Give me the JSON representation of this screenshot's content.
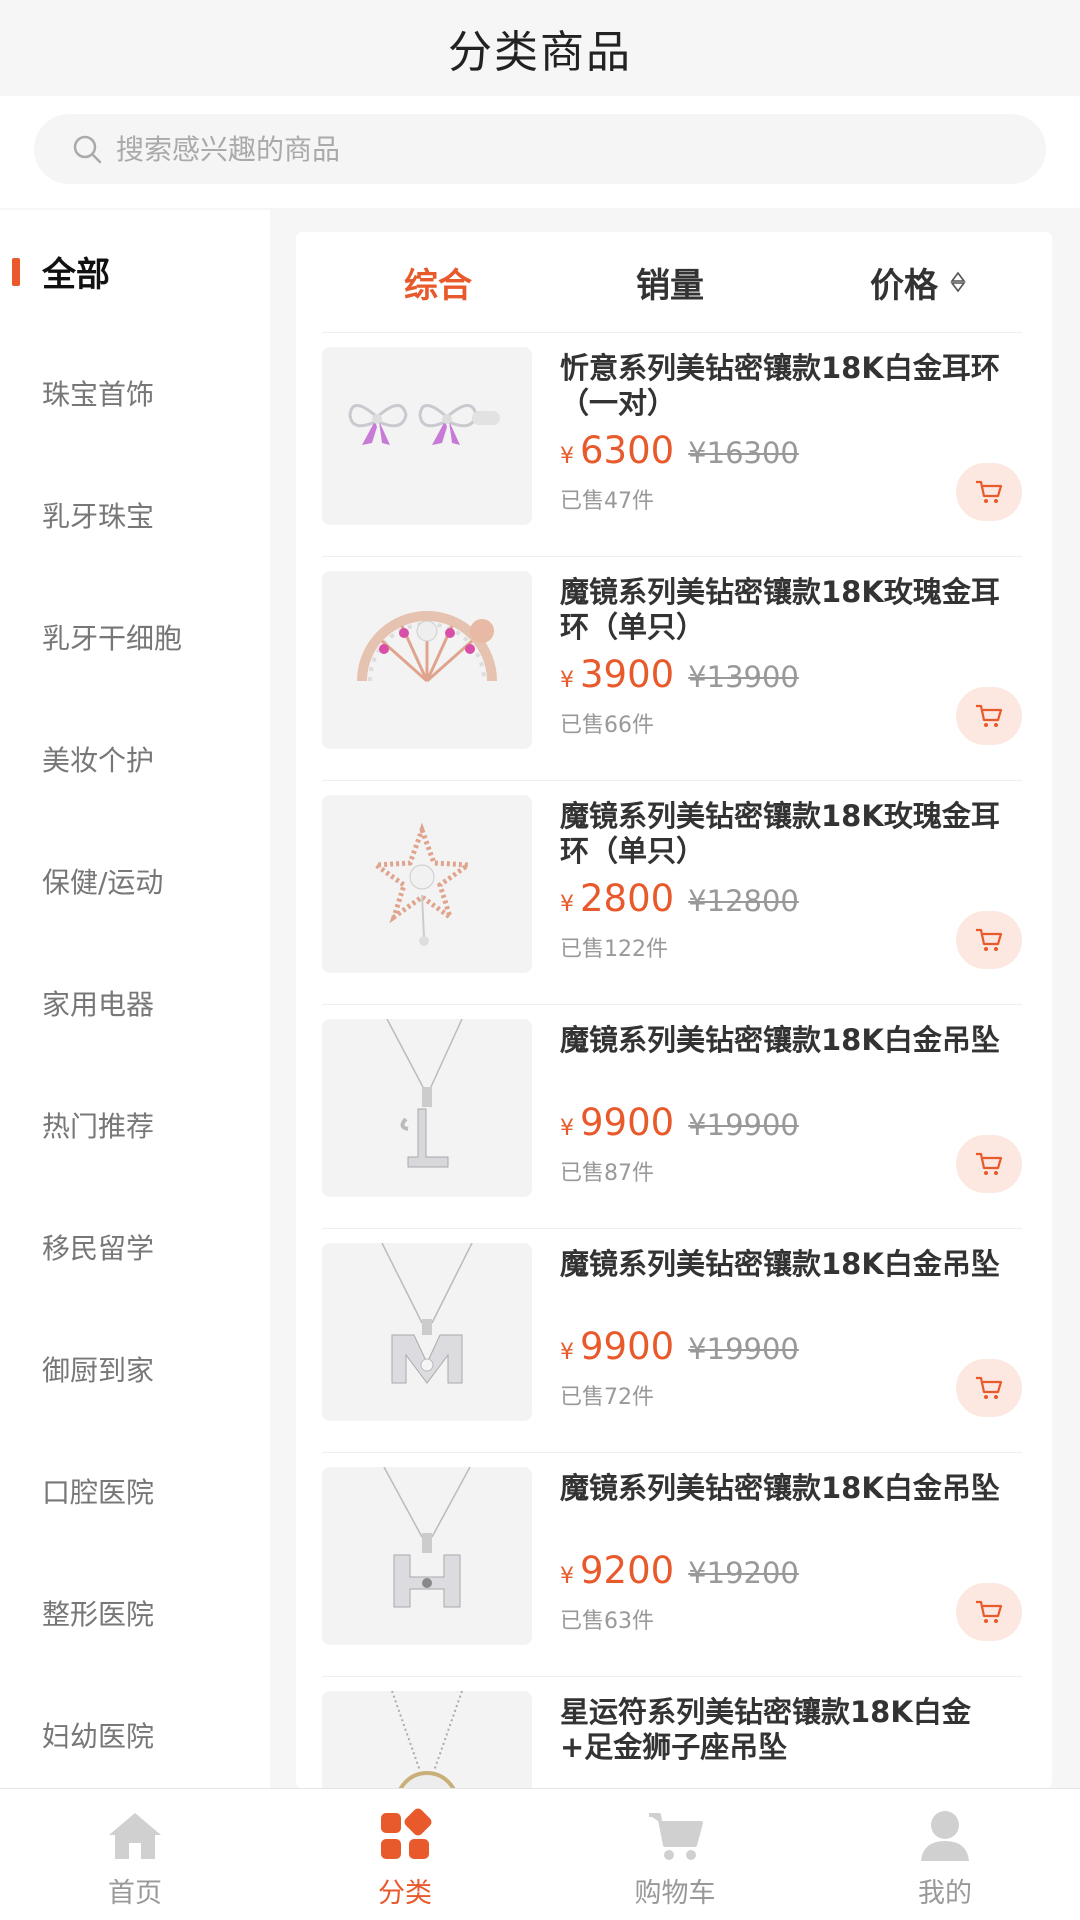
{
  "header": {
    "title": "分类商品"
  },
  "search": {
    "placeholder": "搜索感兴趣的商品"
  },
  "sidebar": {
    "items": [
      {
        "label": "全部",
        "active": true
      },
      {
        "label": "珠宝首饰"
      },
      {
        "label": "乳牙珠宝"
      },
      {
        "label": "乳牙干细胞"
      },
      {
        "label": "美妆个护"
      },
      {
        "label": "保健/运动"
      },
      {
        "label": "家用电器"
      },
      {
        "label": "热门推荐"
      },
      {
        "label": "移民留学"
      },
      {
        "label": "御厨到家"
      },
      {
        "label": "口腔医院"
      },
      {
        "label": "整形医院"
      },
      {
        "label": "妇幼医院"
      }
    ]
  },
  "sort": {
    "comprehensive": "综合",
    "sales": "销量",
    "price": "价格"
  },
  "currency": "¥",
  "products": [
    {
      "name": "忻意系列美钻密镶款18K白金耳环（一对）",
      "price": "6300",
      "original": "¥16300",
      "sold": "已售47件",
      "image": "bow-earrings"
    },
    {
      "name": "魔镜系列美钻密镶款18K玫瑰金耳环（单只）",
      "price": "3900",
      "original": "¥13900",
      "sold": "已售66件",
      "image": "fan-earring"
    },
    {
      "name": "魔镜系列美钻密镶款18K玫瑰金耳环（单只）",
      "price": "2800",
      "original": "¥12800",
      "sold": "已售122件",
      "image": "star-earring"
    },
    {
      "name": "魔镜系列美钻密镶款18K白金吊坠",
      "price": "9900",
      "original": "¥19900",
      "sold": "已售87件",
      "image": "letter-l-pendant"
    },
    {
      "name": "魔镜系列美钻密镶款18K白金吊坠",
      "price": "9900",
      "original": "¥19900",
      "sold": "已售72件",
      "image": "letter-m-pendant"
    },
    {
      "name": "魔镜系列美钻密镶款18K白金吊坠",
      "price": "9200",
      "original": "¥19200",
      "sold": "已售63件",
      "image": "letter-h-pendant"
    },
    {
      "name": "星运符系列美钻密镶款18K白金+足金狮子座吊坠",
      "price": "",
      "original": "",
      "sold": "",
      "image": "zodiac-pendant"
    }
  ],
  "tabbar": {
    "tabs": [
      {
        "label": "首页",
        "icon": "home-icon"
      },
      {
        "label": "分类",
        "icon": "category-icon",
        "active": true
      },
      {
        "label": "购物车",
        "icon": "cart-icon"
      },
      {
        "label": "我的",
        "icon": "user-icon"
      }
    ]
  },
  "colors": {
    "accent": "#e85a2c",
    "cart_bg": "#fde8e1",
    "muted": "#999999"
  }
}
